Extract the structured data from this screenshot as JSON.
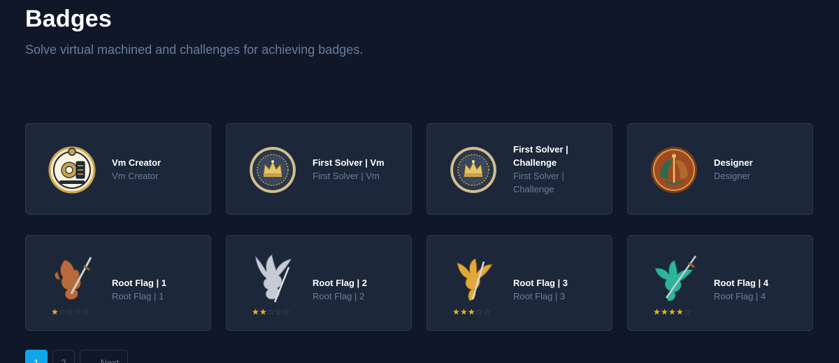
{
  "header": {
    "title": "Badges",
    "subtitle": "Solve virtual machined and challenges for achieving badges."
  },
  "badges": [
    {
      "name": "Vm Creator",
      "description": "Vm Creator",
      "icon": "gear-emblem-icon"
    },
    {
      "name": "First Solver | Vm",
      "description": "First Solver | Vm",
      "icon": "crown-medallion-icon"
    },
    {
      "name": "First Solver | Challenge",
      "description": "First Solver | Challenge",
      "icon": "crown-medallion-icon"
    },
    {
      "name": "Designer",
      "description": "Designer",
      "icon": "dragon-medallion-icon"
    },
    {
      "name": "Root Flag | 1",
      "description": "Root Flag | 1",
      "icon": "phoenix-sword-icon",
      "stars": 1,
      "max_stars": 5,
      "color": "#b86a3c"
    },
    {
      "name": "Root Flag | 2",
      "description": "Root Flag | 2",
      "icon": "phoenix-sword-icon",
      "stars": 2,
      "max_stars": 5,
      "color": "#c7ccd4"
    },
    {
      "name": "Root Flag | 3",
      "description": "Root Flag | 3",
      "icon": "phoenix-sword-icon",
      "stars": 3,
      "max_stars": 5,
      "color": "#e0a93a"
    },
    {
      "name": "Root Flag | 4",
      "description": "Root Flag | 4",
      "icon": "phoenix-sword-icon",
      "stars": 4,
      "max_stars": 5,
      "color": "#2fb39a"
    }
  ],
  "pagination": {
    "pages": [
      "1",
      "2"
    ],
    "current": "1",
    "next_label": "Next",
    "next_arrow": "→"
  },
  "colors": {
    "background": "#0f1729",
    "card": "#1c2739",
    "accent": "#0ea5e9",
    "star": "#e6b422"
  }
}
